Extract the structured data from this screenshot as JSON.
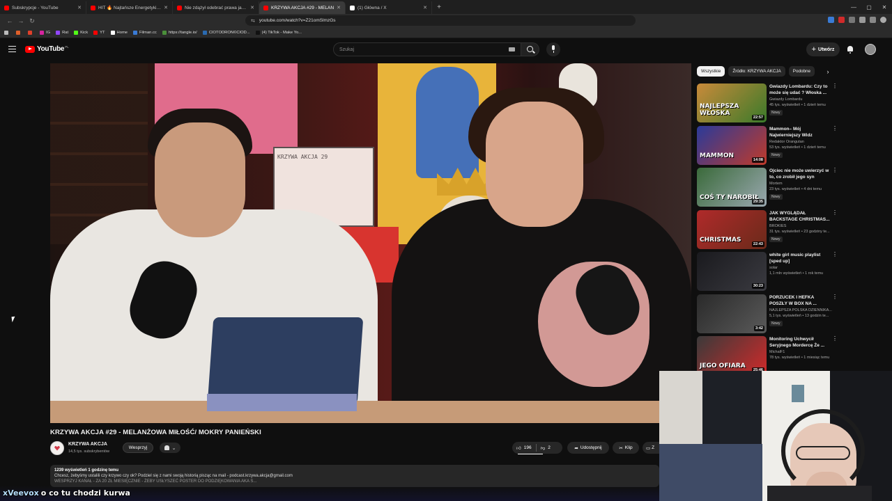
{
  "browser": {
    "tabs": [
      {
        "title": "Subskrypcje - YouTube",
        "active": false,
        "fav_color": "#ff0000"
      },
      {
        "title": "HIT 🔥 Najtańsze Energetyki W HISTO",
        "active": false,
        "fav_color": "#ff0000"
      },
      {
        "title": "Nie zdążył odebrać prawa jazdy a ju",
        "active": false,
        "fav_color": "#ff0000"
      },
      {
        "title": "KRZYWA AKCJA #29 - MELAN",
        "active": true,
        "fav_color": "#ff0000"
      },
      {
        "title": "(1) Główna / X",
        "active": false,
        "fav_color": "#ffffff"
      }
    ],
    "new_tab": "+",
    "url": "youtube.com/watch?v=Z21omSlmzGs",
    "bookmarks": [
      {
        "label": "",
        "color": "#e0602a"
      },
      {
        "label": "",
        "color": "#e0402a"
      },
      {
        "label": "IG",
        "color": "#d6249f"
      },
      {
        "label": "Rat",
        "color": "#9146ff"
      },
      {
        "label": "Kick",
        "color": "#53fc18"
      },
      {
        "label": "YT",
        "color": "#ff0000"
      },
      {
        "label": "Home",
        "color": "#ffffff"
      },
      {
        "label": "Filman.cc",
        "color": "#3a7bd5"
      },
      {
        "label": "https://tangle.io/",
        "color": "#4a8f3a"
      },
      {
        "label": "CIOTODRON©CIOD...",
        "color": "#2a6ab0"
      },
      {
        "label": "(4) TikTok - Make Yo...",
        "color": "#111111"
      }
    ]
  },
  "masthead": {
    "logo_text": "YouTube",
    "logo_country": "PL",
    "search_placeholder": "Szukaj",
    "create_label": "Utwórz"
  },
  "video": {
    "title": "KRZYWA AKCJA #29 - MELANŻOWA MIŁOŚĆ/ MOKRY PANIEŃSKI",
    "clapper_text": "KRZYWA AKCJA 29",
    "channel_name": "KRZYWA AKCJA",
    "subscribers": "14,5 tys. subskrybentów",
    "support_label": "Wesprzyj",
    "likes": "196",
    "dislikes": "2",
    "share_label": "Udostępnij",
    "clip_label": "Klip",
    "save_label": "Z",
    "desc_meta": "1239 wyświetleń  1 godzinę temu",
    "desc_line1": "Chcesz, żebyśmy ustalili czy krzywo czy ok? Podziel się z nami swoją historią pisząc na mail - podcast.krzywa.akcja@gmail.com",
    "desc_line2": "WESPRZYJ KANAŁ - ZA 20 ZŁ MIESIĘCZNIE - ŻEBY USŁYSZEĆ POSTER DO PODZIĘKOWANIA AKA S..."
  },
  "chips": [
    {
      "label": "Wszystkie",
      "active": true
    },
    {
      "label": "Źródło: KRZYWA AKCJA",
      "active": false
    },
    {
      "label": "Podobne",
      "active": false
    }
  ],
  "recommendations": [
    {
      "title": "Gwiazdy Lombardu: Czy to może się udać ? Włoska ...",
      "channel": "Gwiazdy Lombardu",
      "meta": "45 tys. wyświetleń • 1 dzień temu",
      "badge": "Nowy",
      "duration": "22:57",
      "thumb_text": "NAJLEPSZA WŁOSKA",
      "c1": "#c98a3a",
      "c2": "#3a7a2a"
    },
    {
      "title": "Mammon– Mój Najwierniejszy Widz",
      "channel": "Redaktor Orangutan",
      "meta": "53 tys. wyświetleń • 1 dzień temu",
      "badge": "Nowy",
      "duration": "14:08",
      "thumb_text": "MAMMON",
      "c1": "#2a3a9a",
      "c2": "#c03a2a"
    },
    {
      "title": "Ojciec nie może uwierzyć w to, co zrobił jego syn",
      "channel": "Mortem",
      "meta": "23 tys. wyświetleń • 4 dni temu",
      "badge": "Nowy",
      "duration": "29:35",
      "thumb_text": "COŚ TY NAROBIŁ",
      "c1": "#3a6a3a",
      "c2": "#9aa8b0"
    },
    {
      "title": "JAK WYGLĄDAŁ BACKSTAGE CHRISTMAS...",
      "channel": "BROKIES",
      "meta": "31 tys. wyświetleń • 23 godziny te...",
      "badge": "Nowy",
      "duration": "22:43",
      "thumb_text": "CHRISTMAS",
      "c1": "#b02a2a",
      "c2": "#6a2a1a"
    },
    {
      "title": "white girl music playlist [sped up]",
      "channel": "solar",
      "meta": "1,1 mln wyświetleń • 1 rok temu",
      "badge": "",
      "duration": "30:23",
      "thumb_text": "",
      "c1": "#1a1a1e",
      "c2": "#3a3a40"
    },
    {
      "title": "PORZUCEK I HEFKA POSZŁY W BOX NA ...",
      "channel": "NAJLEPSZA POLSKA DZIENNIKA...",
      "meta": "5,1 tys. wyświetleń • 13 godzin te...",
      "badge": "Nowy",
      "duration": "3:42",
      "thumb_text": "",
      "c1": "#2a2a2a",
      "c2": "#5a5a5a"
    },
    {
      "title": "Monitoring Uchwycił Seryjnego Mordercę Że ...",
      "channel": "MichalF1",
      "meta": "78 tys. wyświetleń • 1 miesiąc temu",
      "badge": "",
      "duration": "25:46",
      "thumb_text": "JEGO OFIARA",
      "c1": "#3a3a3a",
      "c2": "#d02a2a"
    }
  ],
  "chat": {
    "user": "xVeevox",
    "message": "o co tu chodzi kurwa"
  }
}
